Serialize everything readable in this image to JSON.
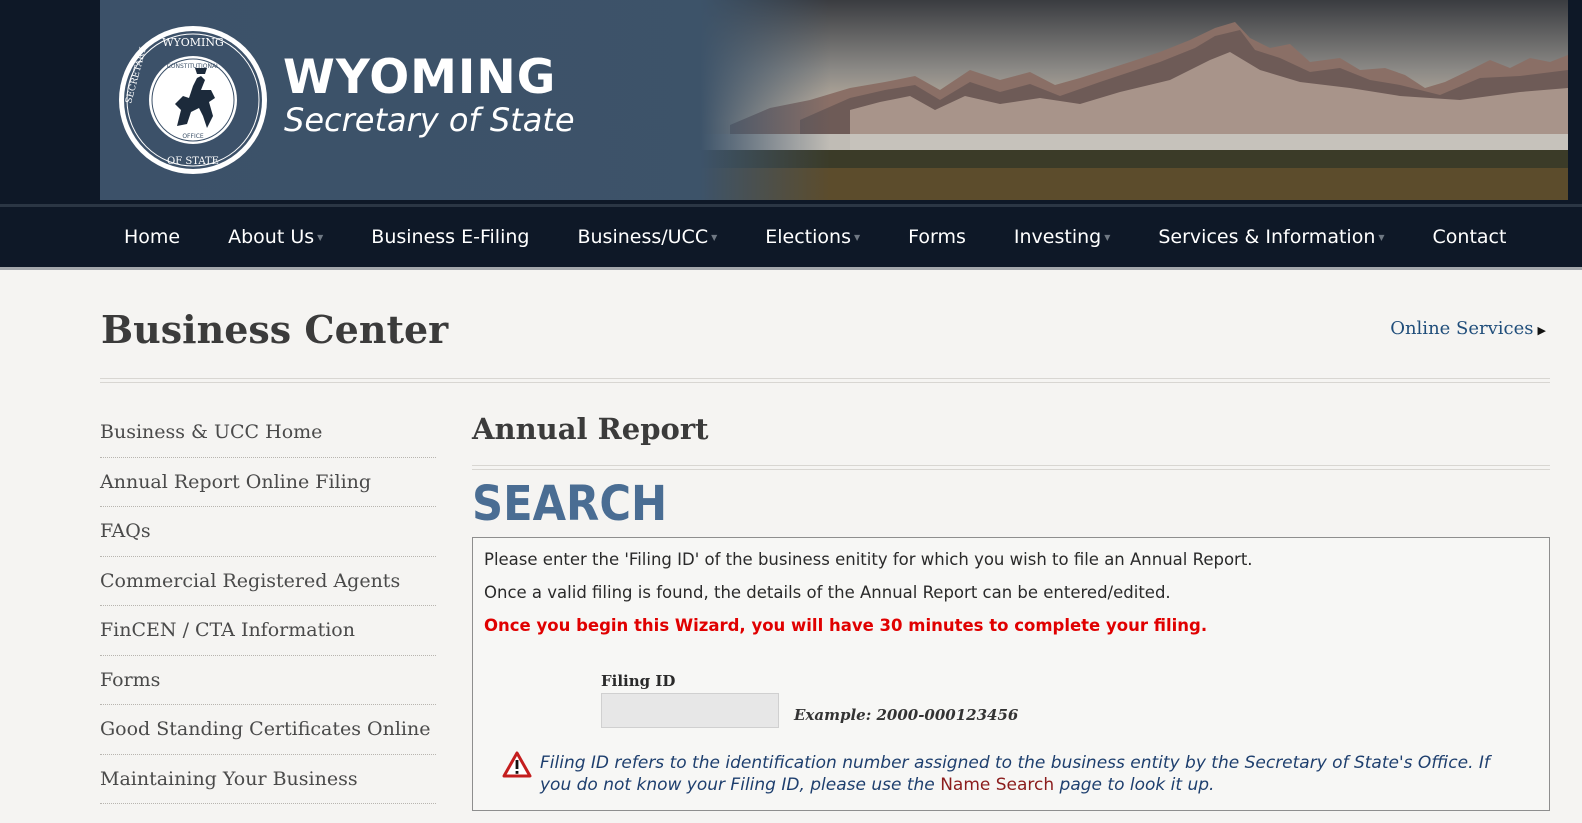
{
  "header": {
    "brand_title": "WYOMING",
    "brand_subtitle": "Secretary of State",
    "seal": {
      "outer_text_top": "WYOMING",
      "outer_text_inner": "CONSTITUTIONAL",
      "outer_text_left": "SECRETARY",
      "outer_text_bottom": "OF STATE",
      "inner_text_bottom": "OFFICE"
    }
  },
  "nav": {
    "items": [
      {
        "label": "Home",
        "dropdown": false
      },
      {
        "label": "About Us",
        "dropdown": true
      },
      {
        "label": "Business E-Filing",
        "dropdown": false
      },
      {
        "label": "Business/UCC",
        "dropdown": true
      },
      {
        "label": "Elections",
        "dropdown": true
      },
      {
        "label": "Forms",
        "dropdown": false
      },
      {
        "label": "Investing",
        "dropdown": true
      },
      {
        "label": "Services & Information",
        "dropdown": true
      },
      {
        "label": "Contact",
        "dropdown": false
      }
    ]
  },
  "page": {
    "title": "Business Center",
    "online_services": "Online Services"
  },
  "sidebar": {
    "items": [
      {
        "label": "Business & UCC Home"
      },
      {
        "label": "Annual Report Online Filing"
      },
      {
        "label": "FAQs"
      },
      {
        "label": "Commercial Registered Agents"
      },
      {
        "label": "FinCEN / CTA Information"
      },
      {
        "label": "Forms"
      },
      {
        "label": "Good Standing Certificates Online"
      },
      {
        "label": "Maintaining Your Business"
      }
    ]
  },
  "content": {
    "section_heading": "Annual Report",
    "search_title": "SEARCH",
    "line1": "Please enter the 'Filing ID' of the business enitity for which you wish to file an Annual Report.",
    "line2": "Once a valid filing is found, the details of the Annual Report can be entered/edited.",
    "line3": "Once you begin this Wizard, you will have 30 minutes to complete your filing.",
    "filing_id_label": "Filing ID",
    "filing_id_value": "",
    "example": "Example: 2000-000123456",
    "note_before": "Filing ID refers to the identification number assigned to the business entity by the Secretary of State's Office. If you do not know your Filing ID, please use the ",
    "note_link": "Name Search",
    "note_after": " page to look it up."
  },
  "colors": {
    "nav_bg": "#0e1827",
    "search_title": "#4a6d93",
    "warning_red": "#e00000",
    "note_blue": "#1e3f6e",
    "link_red": "#8b1c1c"
  },
  "icons": {
    "warning": "warning-triangle-icon",
    "seal": "cowboy-seal-icon",
    "online_services_arrow": "triangle-right-icon"
  }
}
